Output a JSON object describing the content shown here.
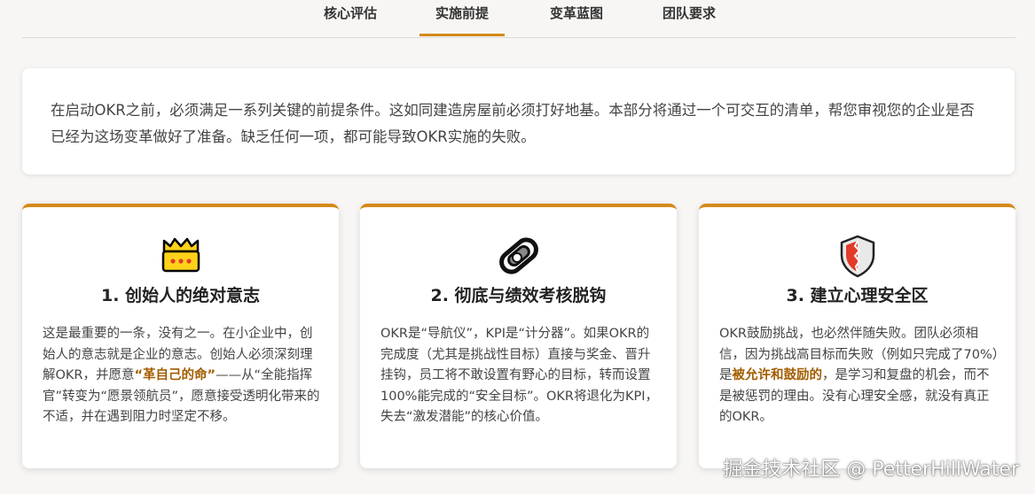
{
  "tabs": [
    {
      "label": "核心评估",
      "active": false
    },
    {
      "label": "实施前提",
      "active": true
    },
    {
      "label": "变革蓝图",
      "active": false
    },
    {
      "label": "团队要求",
      "active": false
    }
  ],
  "intro": "在启动OKR之前，必须满足一系列关键的前提条件。这如同建造房屋前必须打好地基。本部分将通过一个可交互的清单，帮您审视您的企业是否已经为这场变革做好了准备。缺乏任何一项，都可能导致OKR实施的失败。",
  "cards": [
    {
      "icon": "crown-icon",
      "title": "1. 创始人的绝对意志",
      "text_before": "这是最重要的一条，没有之一。在小企业中，创始人的意志就是企业的意志。创始人必须深刻理解OKR，并愿意",
      "highlight": "“革自己的命”",
      "text_after": "——从“全能指挥官”转变为“愿景领航员”，愿意接受透明化带来的不适，并在遇到阻力时坚定不移。"
    },
    {
      "icon": "link-icon",
      "title": "2. 彻底与绩效考核脱钩",
      "text_before": "OKR是“导航仪”，KPI是“计分器”。如果OKR的完成度（尤其是挑战性目标）直接与奖金、晋升挂钩，员工将不敢设置有野心的目标，转而设置100%能完成的“安全目标”。OKR将退化为KPI，失去“激发潜能”的核心价值。",
      "highlight": "",
      "text_after": ""
    },
    {
      "icon": "shield-icon",
      "title": "3. 建立心理安全区",
      "text_before": "OKR鼓励挑战，也必然伴随失败。团队必须相信，因为挑战高目标而失败（例如只完成了70%）是",
      "highlight": "被允许和鼓励的",
      "text_after": "，是学习和复盘的机会，而不是被惩罚的理由。没有心理安全感，就没有真正的OKR。"
    }
  ],
  "watermark": "掘金技术社区 @ PetterHillWater",
  "colors": {
    "accent": "#d48a1a",
    "highlight": "#a35d00"
  }
}
